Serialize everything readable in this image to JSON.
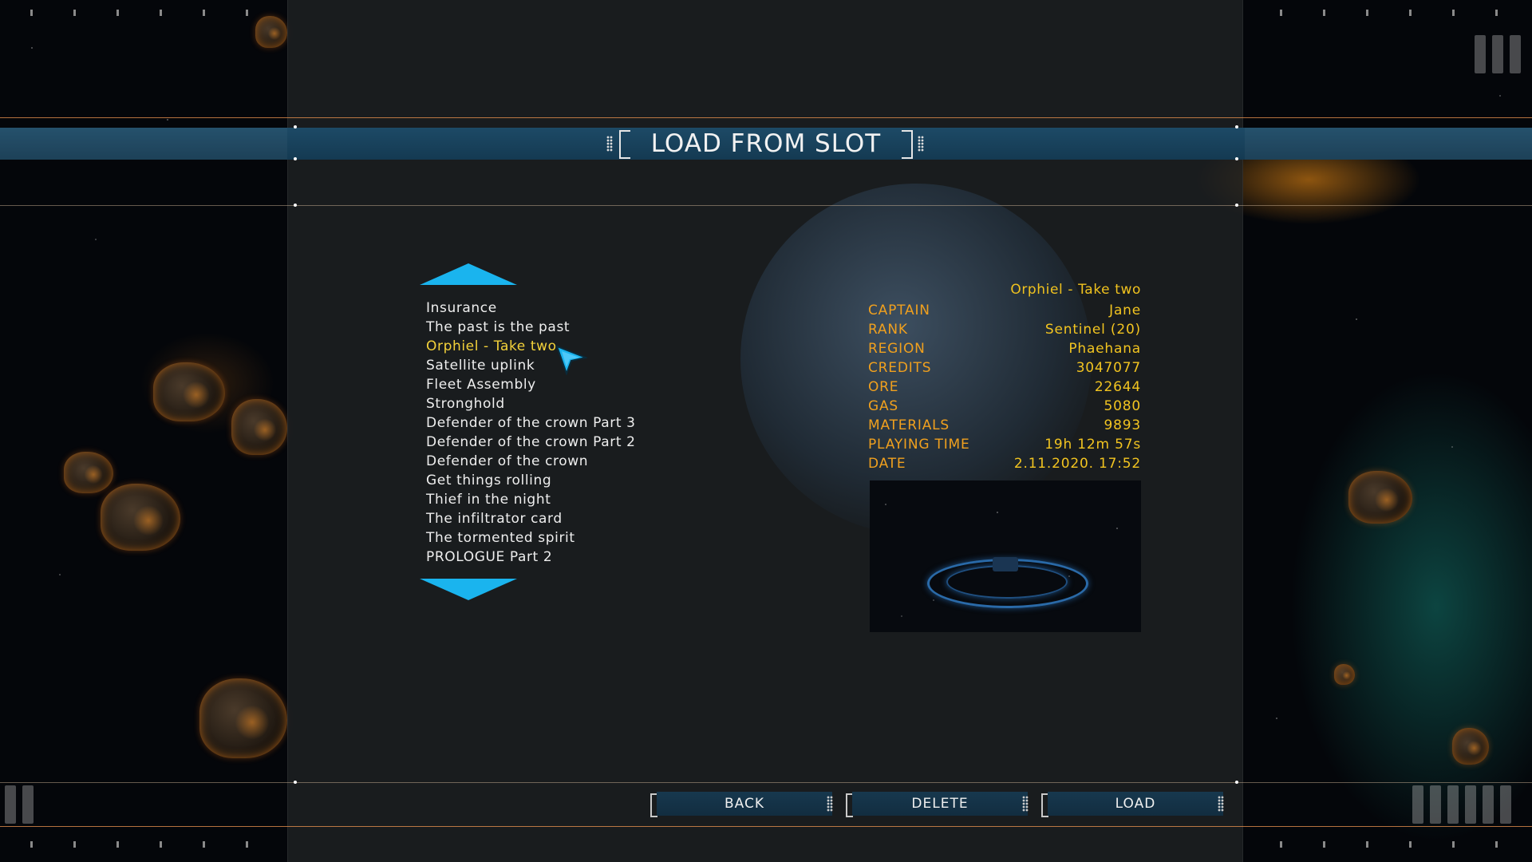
{
  "screen": {
    "title": "LOAD FROM SLOT"
  },
  "slots": {
    "selected_index": 2,
    "items": [
      "Insurance",
      "The past is the past",
      "Orphiel - Take two",
      "Satellite uplink",
      "Fleet Assembly",
      "Stronghold",
      "Defender of the crown Part 3",
      "Defender of the crown Part 2",
      "Defender of the crown",
      "Get things rolling",
      "Thief in the night",
      "The infiltrator card",
      "The tormented spirit",
      "PROLOGUE Part 2"
    ]
  },
  "details": {
    "save_name": "Orphiel - Take two",
    "rows": [
      {
        "label": "CAPTAIN",
        "value": "Jane"
      },
      {
        "label": "RANK",
        "value": "Sentinel (20)"
      },
      {
        "label": "REGION",
        "value": "Phaehana"
      },
      {
        "label": "CREDITS",
        "value": "3047077"
      },
      {
        "label": "ORE",
        "value": "22644"
      },
      {
        "label": "GAS",
        "value": "5080"
      },
      {
        "label": "MATERIALS",
        "value": "9893"
      },
      {
        "label": "PLAYING TIME",
        "value": "19h 12m 57s"
      },
      {
        "label": "DATE",
        "value": "2.11.2020. 17:52"
      }
    ]
  },
  "buttons": {
    "back": "BACK",
    "delete": "DELETE",
    "load": "LOAD"
  },
  "colors": {
    "accent_blue": "#1ab4ee",
    "selected_text": "#f4d23a",
    "detail_label": "#f0a01e",
    "detail_value": "#f2c420",
    "title_bar": "#1d4a66",
    "orange_line": "#f09650"
  },
  "icons": {
    "scroll_up": "triangle-up",
    "scroll_down": "triangle-down",
    "cursor": "arrow-pointer"
  }
}
